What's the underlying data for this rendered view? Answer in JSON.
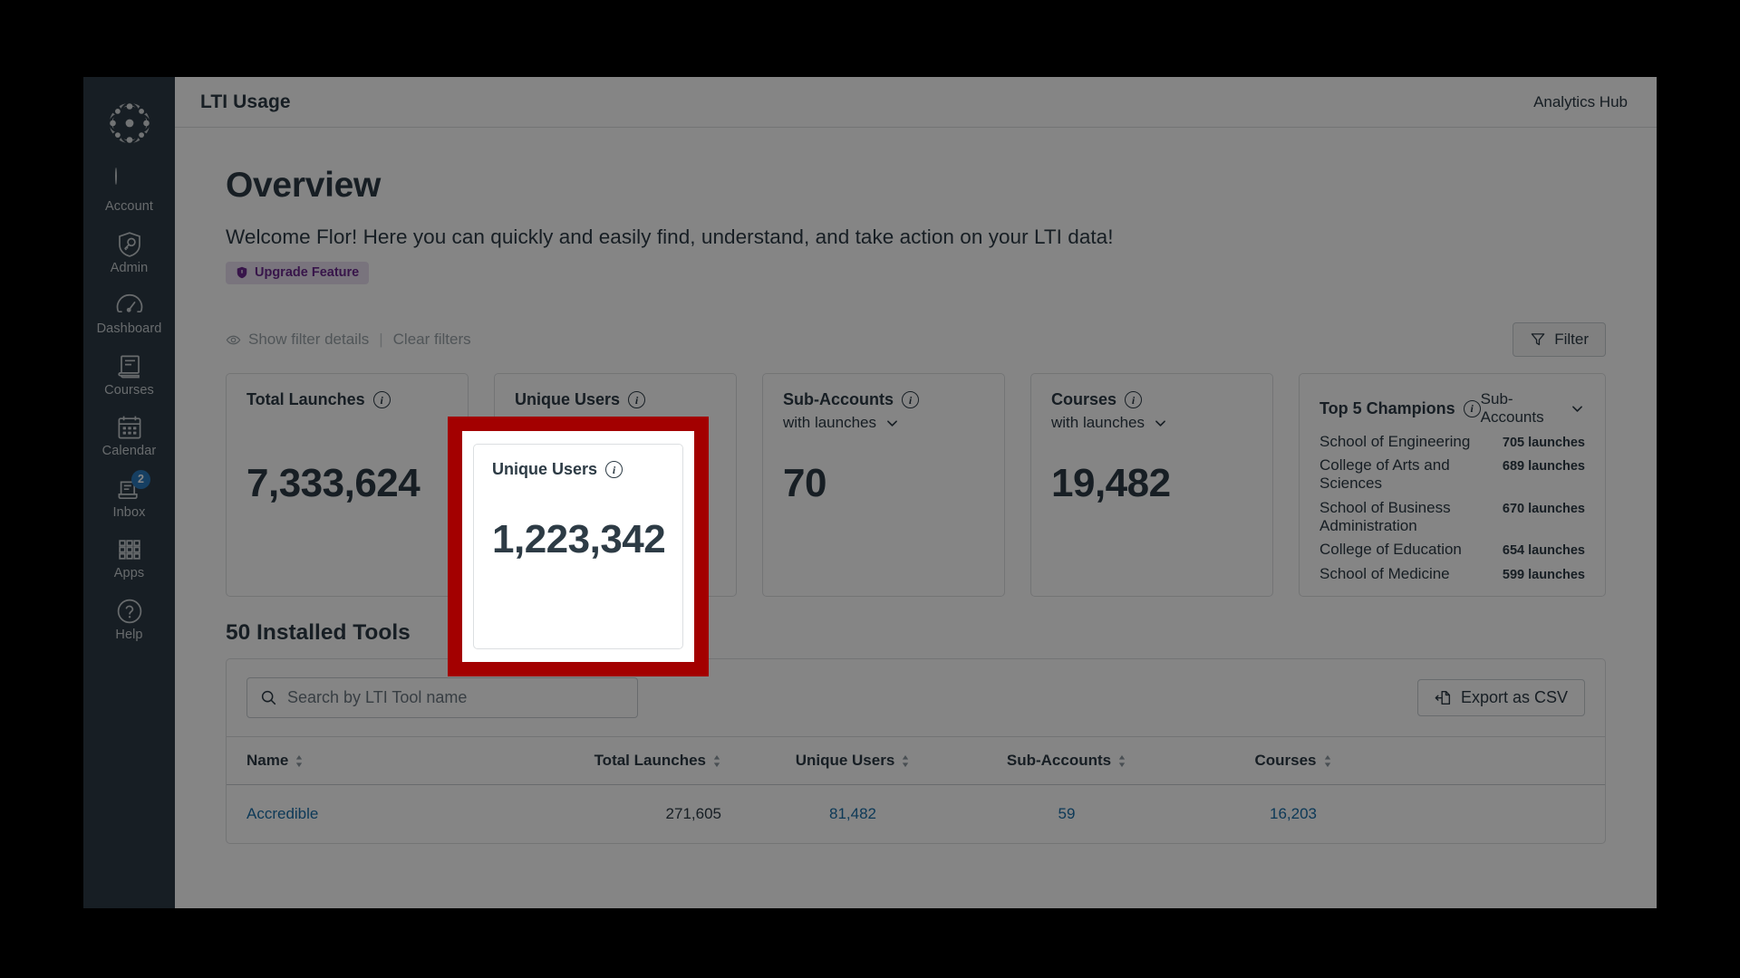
{
  "nav": {
    "logo_icon": "canvas-logo-icon",
    "items": [
      {
        "label": "Account",
        "icon": "avatar-icon"
      },
      {
        "label": "Admin",
        "icon": "shield-key-icon"
      },
      {
        "label": "Dashboard",
        "icon": "speedometer-icon"
      },
      {
        "label": "Courses",
        "icon": "book-icon"
      },
      {
        "label": "Calendar",
        "icon": "calendar-icon"
      },
      {
        "label": "Inbox",
        "icon": "inbox-icon",
        "badge": "2"
      },
      {
        "label": "Apps",
        "icon": "grid-apps-icon"
      },
      {
        "label": "Help",
        "icon": "question-circle-icon"
      }
    ]
  },
  "topbar": {
    "title": "LTI Usage",
    "brand": "Analytics Hub"
  },
  "overview": {
    "heading": "Overview",
    "welcome": "Welcome Flor! Here you can quickly and easily find, understand, and take action on your LTI data!",
    "upgrade_badge": "Upgrade Feature",
    "upgrade_icon": "shield-badge-icon"
  },
  "filters": {
    "show_details": "Show filter details",
    "divider": "|",
    "clear": "Clear filters",
    "eye_icon": "eye-icon",
    "filter_button": "Filter",
    "filter_icon": "funnel-icon"
  },
  "cards": {
    "total_launches": {
      "title": "Total Launches",
      "value": "7,333,624",
      "info_icon": "info-icon"
    },
    "unique_users": {
      "title": "Unique Users",
      "value": "1,223,342",
      "info_icon": "info-icon",
      "highlighted": true,
      "highlight_color": "#a30000"
    },
    "sub_accounts": {
      "title": "Sub-Accounts",
      "subtitle": "with launches",
      "value": "70",
      "info_icon": "info-icon",
      "chevron_icon": "chevron-down-icon"
    },
    "courses": {
      "title": "Courses",
      "subtitle": "with launches",
      "value": "19,482",
      "info_icon": "info-icon",
      "chevron_icon": "chevron-down-icon"
    },
    "champions": {
      "title": "Top 5 Champions",
      "info_icon": "info-icon",
      "selector_value": "Sub-Accounts",
      "selector_icon": "chevron-down-icon",
      "rows": [
        {
          "name": "School of Engineering",
          "count": "705 launches"
        },
        {
          "name": "College of Arts and Sciences",
          "count": "689 launches"
        },
        {
          "name": "School of Business Administration",
          "count": "670 launches"
        },
        {
          "name": "College of Education",
          "count": "654 launches"
        },
        {
          "name": "School of Medicine",
          "count": "599 launches"
        }
      ]
    }
  },
  "tools": {
    "heading": "50 Installed Tools",
    "search_placeholder": "Search by LTI Tool name",
    "search_value": "",
    "search_icon": "search-icon",
    "export_label": "Export as CSV",
    "export_icon": "export-file-icon",
    "sort_icon": "sort-arrows-icon",
    "columns": [
      {
        "label": "Name"
      },
      {
        "label": "Total Launches"
      },
      {
        "label": "Unique Users"
      },
      {
        "label": "Sub-Accounts"
      },
      {
        "label": "Courses"
      }
    ],
    "rows": [
      {
        "name": "Accredible",
        "total_launches": "271,605",
        "unique_users": "81,482",
        "sub_accounts": "59",
        "courses": "16,203"
      }
    ]
  },
  "colors": {
    "nav_bg": "#2d3b45",
    "text": "#2d3b45",
    "link": "#1a6ea8",
    "badge_purple": "#6b2a8f",
    "badge_blue": "#2b7abc",
    "highlight_red": "#a30000"
  }
}
